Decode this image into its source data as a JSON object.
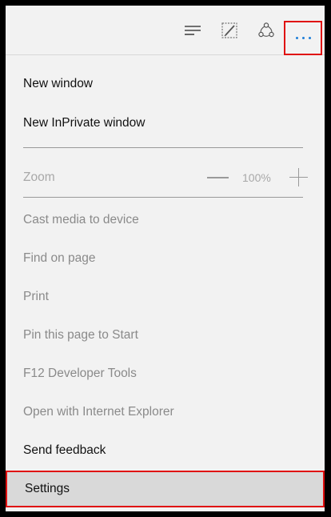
{
  "toolbar": {
    "icons": [
      "hub-icon",
      "web-note-icon",
      "share-icon",
      "more-actions-icon"
    ]
  },
  "menu": {
    "new_window": "New window",
    "new_inprivate_window": "New InPrivate window",
    "zoom_label": "Zoom",
    "zoom_value": "100%",
    "cast_media": "Cast media to device",
    "find_on_page": "Find on page",
    "print": "Print",
    "pin_to_start": "Pin this page to Start",
    "developer_tools": "F12 Developer Tools",
    "open_with_ie": "Open with Internet Explorer",
    "send_feedback": "Send feedback",
    "settings": "Settings"
  },
  "colors": {
    "highlight_border": "#e01010",
    "accent": "#1e7fd8",
    "panel_bg": "#f2f2f2",
    "selected_bg": "#d9d9d9"
  }
}
